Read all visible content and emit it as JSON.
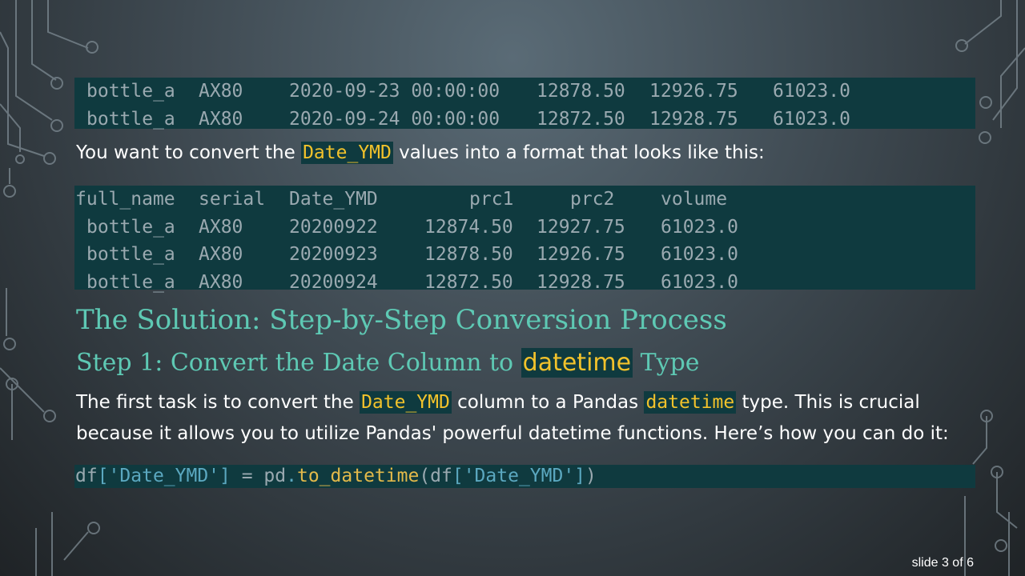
{
  "table_top": {
    "rows": [
      [
        "bottle_a",
        "AX80",
        "2020-09-23 00:00:00",
        "12878.50",
        "12926.75",
        "61023.0"
      ],
      [
        "bottle_a",
        "AX80",
        "2020-09-24 00:00:00",
        "12872.50",
        "12928.75",
        "61023.0"
      ]
    ]
  },
  "intro": {
    "before": "You want to convert the ",
    "code": "Date_YMD",
    "after": " values into a format that looks like this:"
  },
  "table_bottom": {
    "headers": [
      "full_name",
      "serial",
      "Date_YMD",
      "prc1",
      "prc2",
      "volume"
    ],
    "rows": [
      [
        "bottle_a",
        "AX80",
        "20200922",
        "12874.50",
        "12927.75",
        "61023.0"
      ],
      [
        "bottle_a",
        "AX80",
        "20200923",
        "12878.50",
        "12926.75",
        "61023.0"
      ],
      [
        "bottle_a",
        "AX80",
        "20200924",
        "12872.50",
        "12928.75",
        "61023.0"
      ]
    ]
  },
  "solution_heading": "The Solution: Step-by-Step Conversion Process",
  "step1": {
    "before": "Step 1: Convert the Date Column to ",
    "code": "datetime",
    "after": " Type"
  },
  "para": {
    "l1_a": "The first task is to convert the ",
    "l1_code1": "Date_YMD",
    "l1_b": " column to a Pandas ",
    "l1_code2": "datetime",
    "l1_c": " type. This is crucial",
    "l2": "because it allows you to utilize Pandas' powerful datetime functions. Here’s how you can do it:"
  },
  "code": {
    "t1": "df",
    "t2": "['Date_YMD']",
    "t3": " = ",
    "t4": "pd",
    "t5": ".",
    "t6": "to_datetime",
    "t7": "(df",
    "t8": "['Date_YMD']",
    "t9": ")"
  },
  "slide_number": "slide 3 of 6",
  "colors": {
    "code_bg": "#0f3a3f",
    "heading": "#5ec9b4",
    "highlight_text": "#f2c22b"
  }
}
